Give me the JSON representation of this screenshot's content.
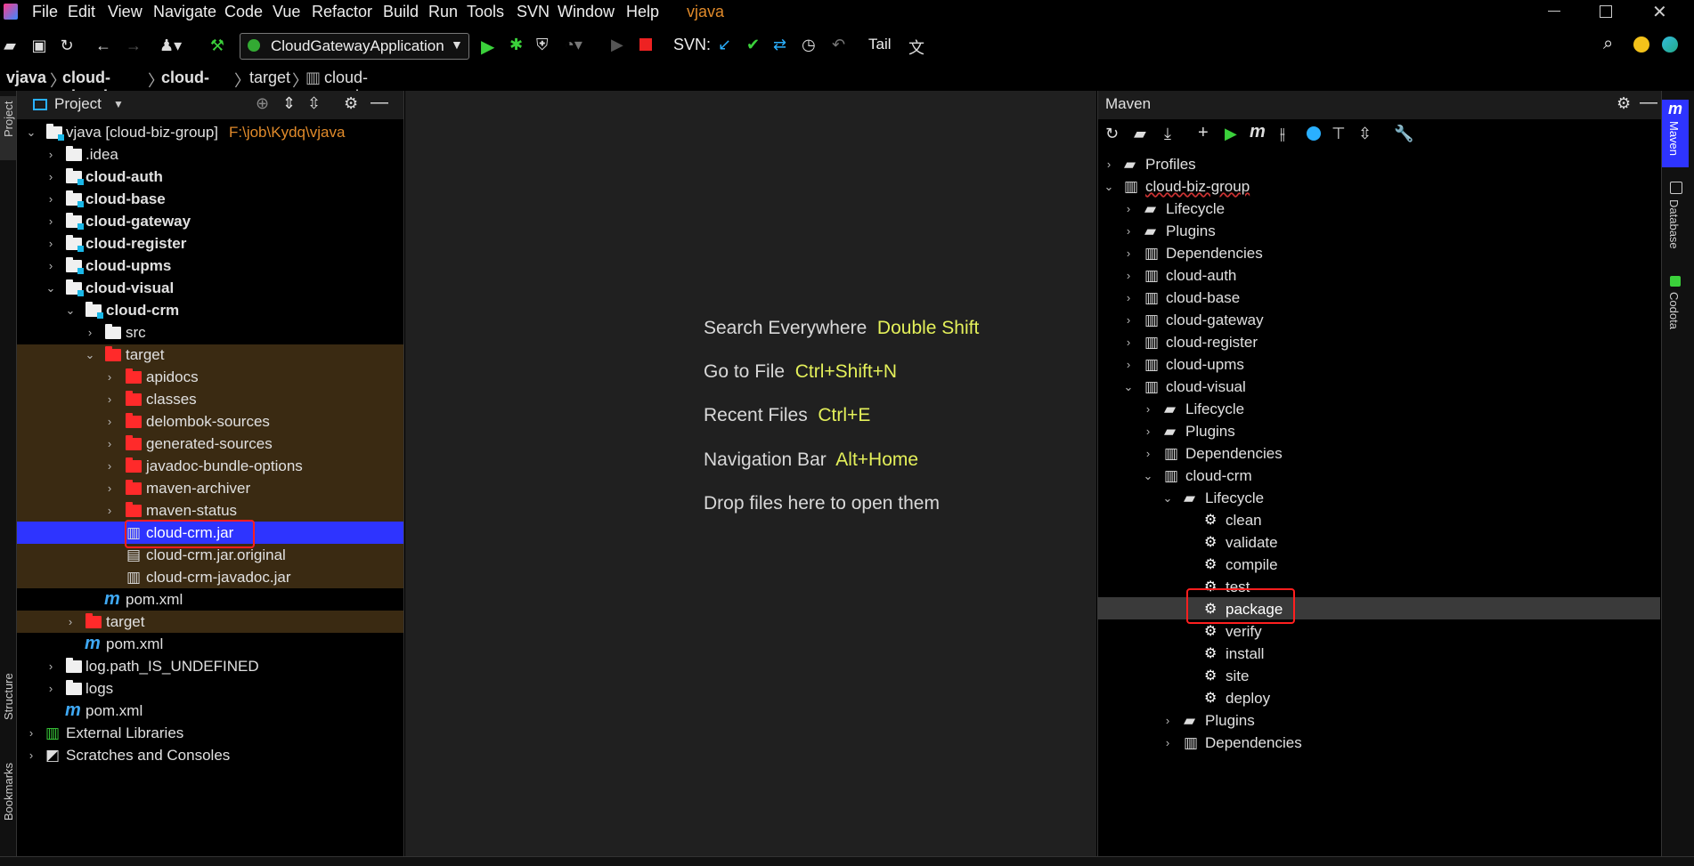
{
  "menu": {
    "items": [
      "File",
      "Edit",
      "View",
      "Navigate",
      "Code",
      "Vue",
      "Refactor",
      "Build",
      "Run",
      "Tools",
      "SVN",
      "Window",
      "Help"
    ],
    "project_name": "vjava"
  },
  "toolbar": {
    "run_config": "CloudGatewayApplication",
    "svn_label": "SVN:",
    "tail_label": "Tail"
  },
  "breadcrumb": [
    "vjava",
    "cloud-visual",
    "cloud-crm",
    "target",
    "cloud-crm.jar"
  ],
  "project_panel": {
    "title": "Project",
    "root_label": "vjava [cloud-biz-group]",
    "root_path": "F:\\job\\Kydq\\vjava",
    "tree": [
      {
        "label": ".idea"
      },
      {
        "label": "cloud-auth"
      },
      {
        "label": "cloud-base"
      },
      {
        "label": "cloud-gateway"
      },
      {
        "label": "cloud-register"
      },
      {
        "label": "cloud-upms"
      },
      {
        "label": "cloud-visual"
      },
      {
        "label": "cloud-crm"
      },
      {
        "label": "src"
      },
      {
        "label": "target"
      },
      {
        "label": "apidocs"
      },
      {
        "label": "classes"
      },
      {
        "label": "delombok-sources"
      },
      {
        "label": "generated-sources"
      },
      {
        "label": "javadoc-bundle-options"
      },
      {
        "label": "maven-archiver"
      },
      {
        "label": "maven-status"
      },
      {
        "label": "cloud-crm.jar"
      },
      {
        "label": "cloud-crm.jar.original"
      },
      {
        "label": "cloud-crm-javadoc.jar"
      },
      {
        "label": "pom.xml"
      },
      {
        "label": "target"
      },
      {
        "label": "pom.xml"
      },
      {
        "label": "log.path_IS_UNDEFINED"
      },
      {
        "label": "logs"
      },
      {
        "label": "pom.xml"
      },
      {
        "label": "External Libraries"
      },
      {
        "label": "Scratches and Consoles"
      }
    ]
  },
  "editor": {
    "hints": [
      {
        "label": "Search Everywhere",
        "key": "Double Shift"
      },
      {
        "label": "Go to File",
        "key": "Ctrl+Shift+N"
      },
      {
        "label": "Recent Files",
        "key": "Ctrl+E"
      },
      {
        "label": "Navigation Bar",
        "key": "Alt+Home"
      }
    ],
    "drop_text": "Drop files here to open them"
  },
  "maven_panel": {
    "title": "Maven",
    "tree": [
      {
        "label": "Profiles"
      },
      {
        "label": "cloud-biz-group"
      },
      {
        "label": "Lifecycle"
      },
      {
        "label": "Plugins"
      },
      {
        "label": "Dependencies"
      },
      {
        "label": "cloud-auth"
      },
      {
        "label": "cloud-base"
      },
      {
        "label": "cloud-gateway"
      },
      {
        "label": "cloud-register"
      },
      {
        "label": "cloud-upms"
      },
      {
        "label": "cloud-visual"
      },
      {
        "label": "Lifecycle"
      },
      {
        "label": "Plugins"
      },
      {
        "label": "Dependencies"
      },
      {
        "label": "cloud-crm"
      },
      {
        "label": "Lifecycle"
      },
      {
        "label": "clean"
      },
      {
        "label": "validate"
      },
      {
        "label": "compile"
      },
      {
        "label": "test"
      },
      {
        "label": "package"
      },
      {
        "label": "verify"
      },
      {
        "label": "install"
      },
      {
        "label": "site"
      },
      {
        "label": "deploy"
      },
      {
        "label": "Plugins"
      },
      {
        "label": "Dependencies"
      }
    ]
  },
  "side_tabs": {
    "left": [
      "Project",
      "Structure",
      "Bookmarks"
    ],
    "right": [
      "Maven",
      "Database",
      "Codota"
    ]
  },
  "colors": {
    "selection": "#2e34ff",
    "excluded": "#3a2a12",
    "highlight_box": "#ff1f1f",
    "hint_key": "#e4f05a",
    "path": "#e08a2a"
  }
}
